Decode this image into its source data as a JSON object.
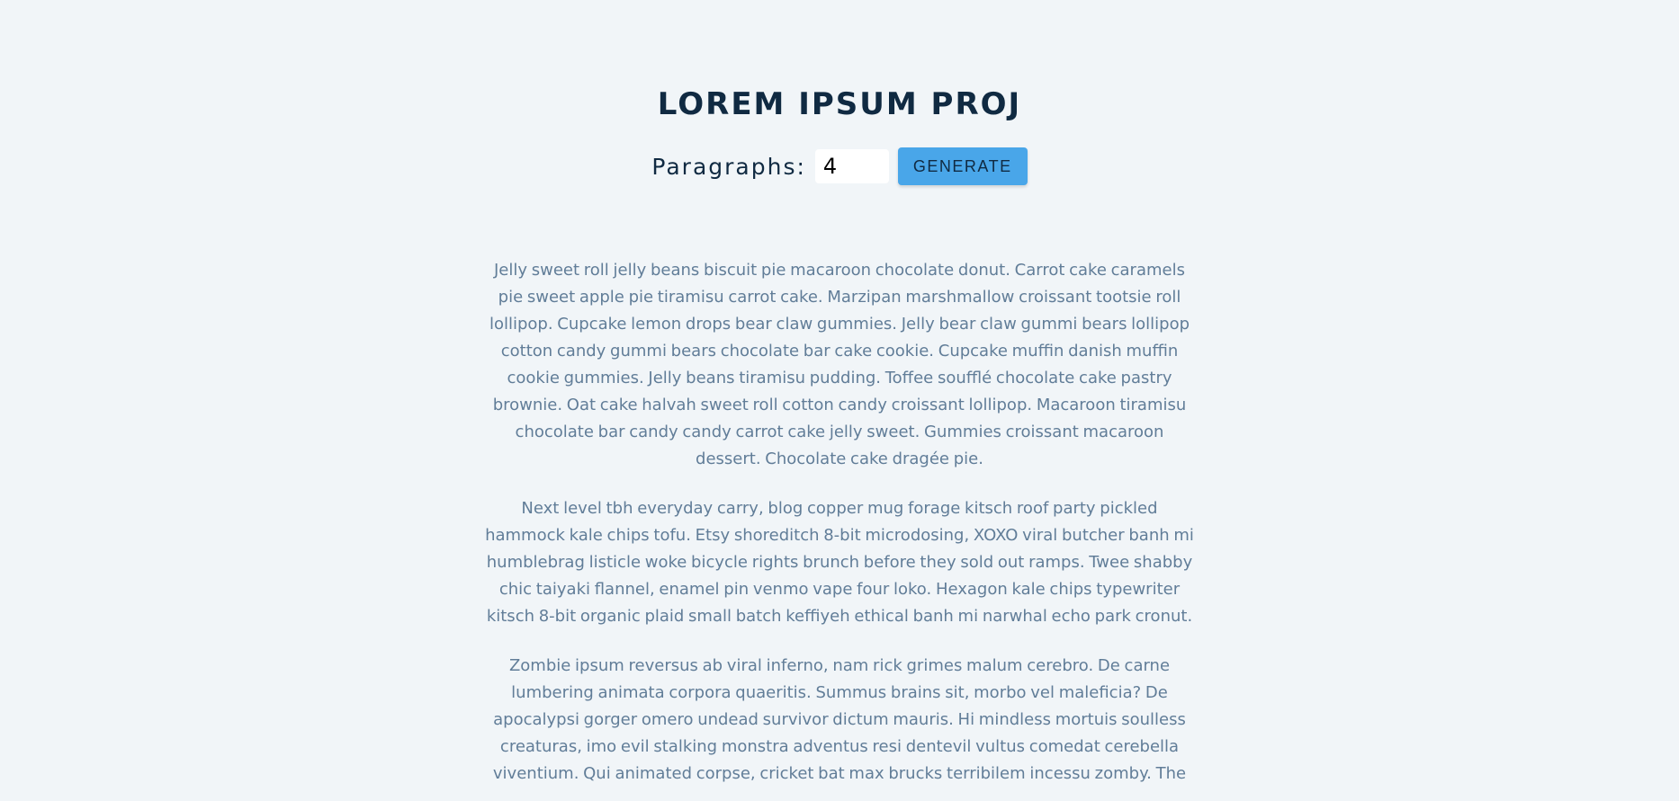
{
  "header": {
    "title": "LOREM IPSUM PROJ"
  },
  "form": {
    "label": "Paragraphs:",
    "value": "4",
    "button_label": "GENERATE"
  },
  "paragraphs": [
    "Jelly sweet roll jelly beans biscuit pie macaroon chocolate donut. Carrot cake caramels pie sweet apple pie tiramisu carrot cake. Marzipan marshmallow croissant tootsie roll lollipop. Cupcake lemon drops bear claw gummies. Jelly bear claw gummi bears lollipop cotton candy gummi bears chocolate bar cake cookie. Cupcake muffin danish muffin cookie gummies. Jelly beans tiramisu pudding. Toffee soufflé chocolate cake pastry brownie. Oat cake halvah sweet roll cotton candy croissant lollipop. Macaroon tiramisu chocolate bar candy candy carrot cake jelly sweet. Gummies croissant macaroon dessert. Chocolate cake dragée pie.",
    "Next level tbh everyday carry, blog copper mug forage kitsch roof party pickled hammock kale chips tofu. Etsy shoreditch 8-bit microdosing, XOXO viral butcher banh mi humblebrag listicle woke bicycle rights brunch before they sold out ramps. Twee shabby chic taiyaki flannel, enamel pin venmo vape four loko. Hexagon kale chips typewriter kitsch 8-bit organic plaid small batch keffiyeh ethical banh mi narwhal echo park cronut.",
    "Zombie ipsum reversus ab viral inferno, nam rick grimes malum cerebro. De carne lumbering animata corpora quaeritis. Summus brains sit, morbo vel maleficia? De apocalypsi gorger omero undead survivor dictum mauris. Hi mindless mortuis soulless creaturas, imo evil stalking monstra adventus resi dentevil vultus comedat cerebella viventium. Qui animated corpse, cricket bat max brucks terribilem incessu zomby. The"
  ],
  "colors": {
    "background": "#f1f5f8",
    "title": "#102a42",
    "button": "#49a6e9",
    "text": "#617d98"
  }
}
